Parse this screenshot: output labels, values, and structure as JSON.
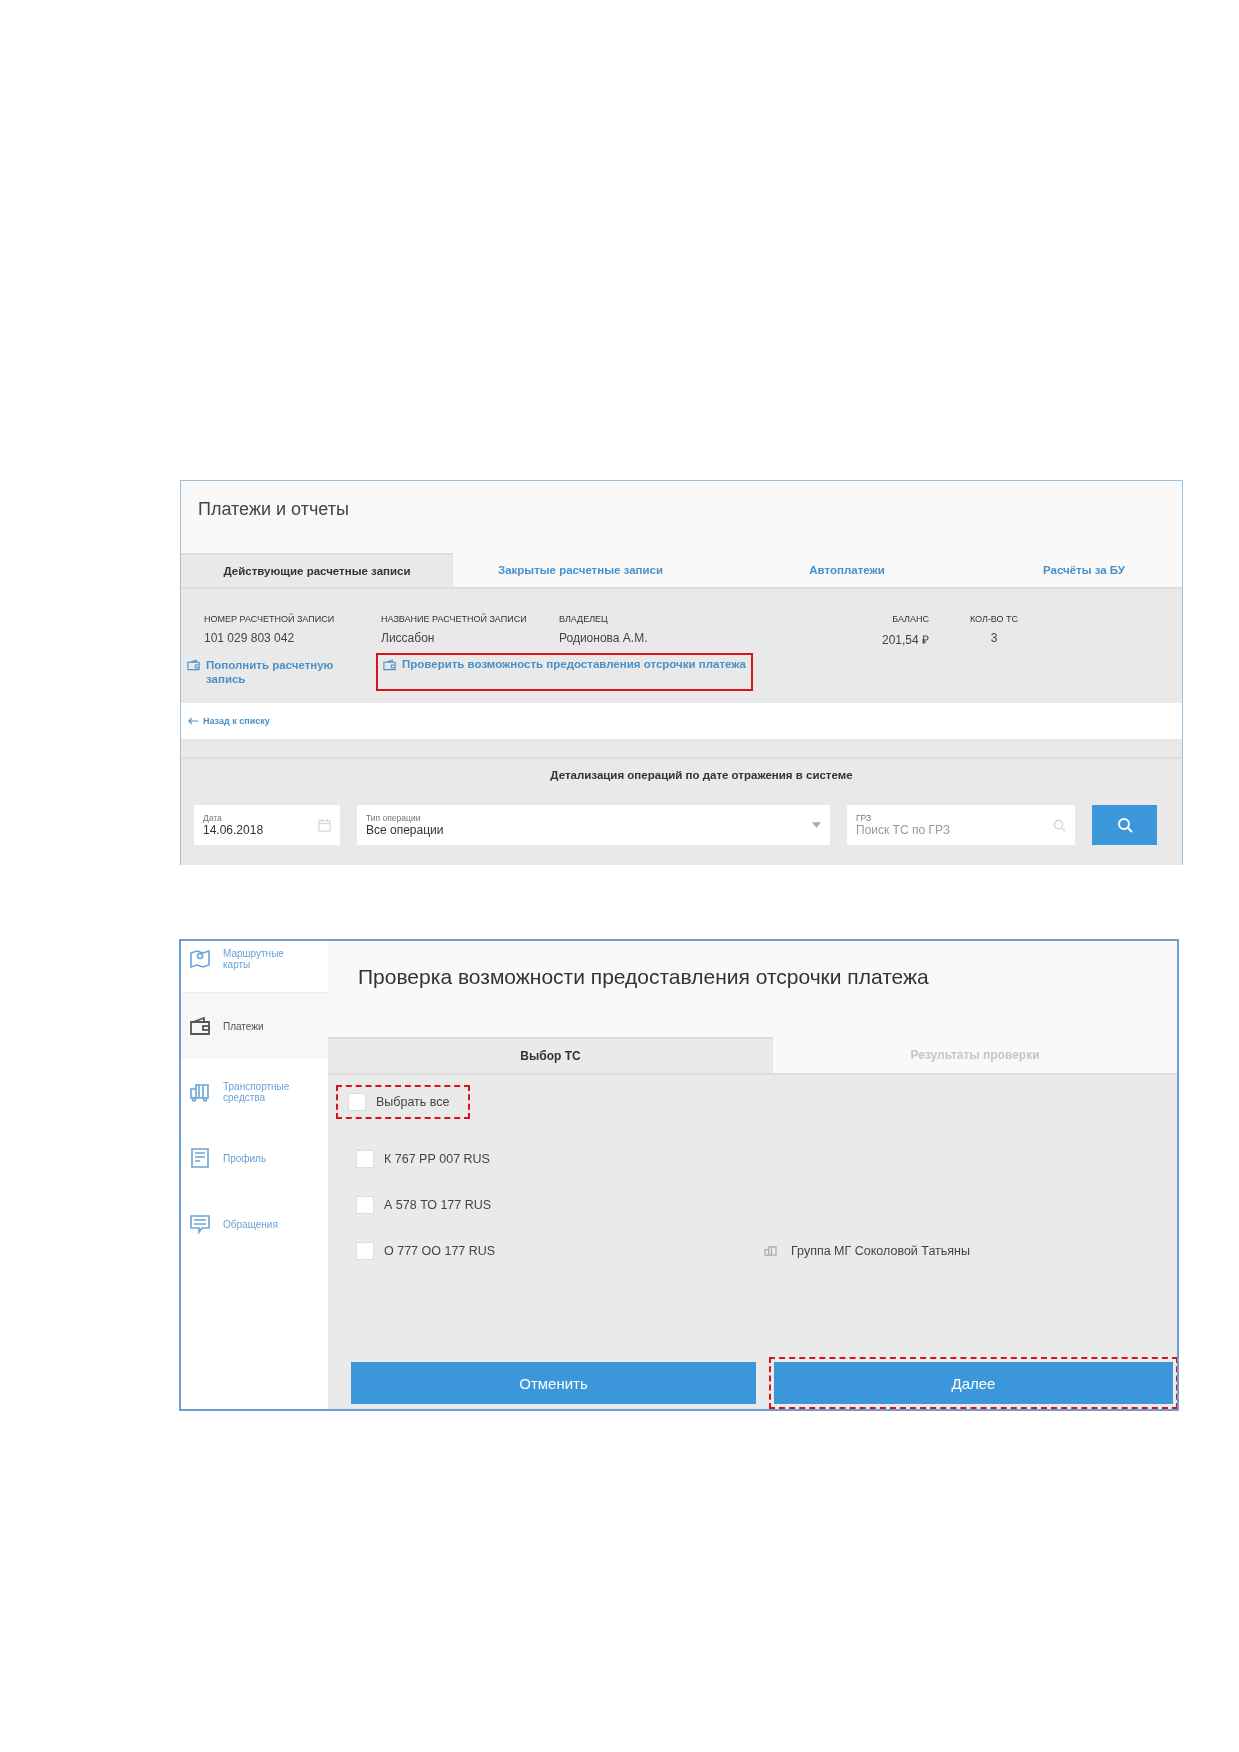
{
  "payments_window": {
    "title": "Платежи и отчеты",
    "tabs": [
      {
        "label": "Действующие расчетные записи",
        "selected": true
      },
      {
        "label": "Закрытые расчетные записи",
        "selected": false
      },
      {
        "label": "Автоплатежи",
        "selected": false
      },
      {
        "label": "Расчёты за БУ",
        "selected": false
      }
    ],
    "account": {
      "columns": [
        "НОМЕР РАСЧЕТНОЙ ЗАПИСИ",
        "НАЗВАНИЕ РАСЧЕТНОЙ ЗАПИСИ",
        "ВЛАДЕЛЕЦ",
        "БАЛАНС",
        "КОЛ-ВО ТС"
      ],
      "row": [
        "101 029 803 042",
        "Лиссабон",
        "Родионова А.М.",
        "201,54 ₽",
        "3"
      ],
      "actions": [
        {
          "label": "Пополнить расчетную запись",
          "highlighted": false
        },
        {
          "label": "Проверить возможность предоставления отсрочки платежа",
          "highlighted": true
        }
      ]
    },
    "back_link": "Назад к списку",
    "details": {
      "title": "Детализация операций по дате отражения в системе",
      "date_field": {
        "label": "Дата",
        "value": "14.06.2018"
      },
      "type_field": {
        "label": "Тип операции",
        "value": "Все операции"
      },
      "plate_field": {
        "label": "ГРЗ",
        "placeholder": "Поиск ТС по ГРЗ"
      }
    }
  },
  "check_window": {
    "sidebar": {
      "items": [
        {
          "label": "Маршрутные карты",
          "selected": false
        },
        {
          "label": "Платежи",
          "selected": true
        },
        {
          "label": "Транспортные средства",
          "selected": false
        },
        {
          "label": "Профиль",
          "selected": false
        },
        {
          "label": "Обращения",
          "selected": false
        }
      ]
    },
    "title": "Проверка возможности предоставления отсрочки платежа",
    "tabs": [
      {
        "label": "Выбор ТС",
        "selected": true
      },
      {
        "label": "Результаты проверки",
        "selected": false
      }
    ],
    "select_all": {
      "label": "Выбрать все",
      "checked": false,
      "highlighted": true
    },
    "vehicles": [
      {
        "plate": "К 767 РР 007 RUS",
        "checked": false
      },
      {
        "plate": "А 578 ТО 177 RUS",
        "checked": false
      },
      {
        "plate": "О 777 ОО 177 RUS",
        "checked": false,
        "group": "Группа МГ Соколовой Татьяны"
      }
    ],
    "buttons": [
      {
        "label": "Отменить",
        "highlighted": false
      },
      {
        "label": "Далее",
        "highlighted": true
      }
    ]
  }
}
